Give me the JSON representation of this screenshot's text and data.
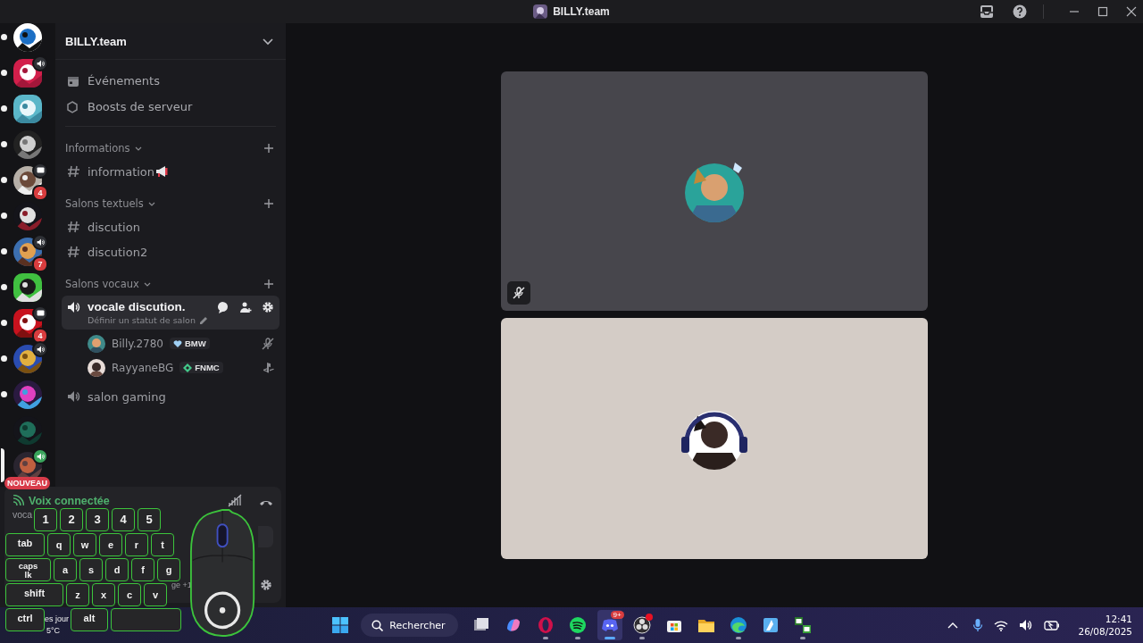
{
  "title_bar": {
    "title": "BILLY.team"
  },
  "servers": [
    {
      "kind": "plain",
      "unread": true,
      "selected": false
    },
    {
      "kind": "voice",
      "unread": true,
      "selected": false
    },
    {
      "kind": "plain",
      "unread": true,
      "selected": false
    },
    {
      "kind": "plain",
      "unread": true,
      "selected": false
    },
    {
      "kind": "message",
      "unread": true,
      "selected": false,
      "badge": "4"
    },
    {
      "kind": "plain",
      "unread": true,
      "selected": false
    },
    {
      "kind": "voice",
      "unread": true,
      "selected": false,
      "badge": "7"
    },
    {
      "kind": "plain",
      "unread": true,
      "selected": false
    },
    {
      "kind": "message",
      "unread": true,
      "selected": false,
      "badge": "4"
    },
    {
      "kind": "voice",
      "unread": true,
      "selected": false
    },
    {
      "kind": "plain",
      "unread": true,
      "selected": false
    },
    {
      "kind": "plain",
      "unread": false,
      "selected": false
    },
    {
      "kind": "voice_live",
      "unread": false,
      "selected": true,
      "tag": "NOUVEAU"
    }
  ],
  "sidebar": {
    "server_name": "BILLY.team",
    "shortcuts": [
      {
        "kind": "events",
        "label": "Événements"
      },
      {
        "kind": "boosts",
        "label": "Boosts de serveur"
      }
    ],
    "categories": [
      {
        "name": "Informations",
        "channels": [
          {
            "kind": "text",
            "name": "information",
            "announce": true,
            "selected": false
          }
        ]
      },
      {
        "name": "Salons textuels",
        "channels": [
          {
            "kind": "text",
            "name": "discution",
            "selected": false
          },
          {
            "kind": "text",
            "name": "discution2",
            "selected": false
          }
        ]
      },
      {
        "name": "Salons vocaux",
        "channels": [
          {
            "kind": "voice",
            "name": "vocale discution.",
            "selected": true,
            "status": "Définir un statut de salon",
            "members": [
              {
                "name": "Billy.2780",
                "tag": {
                  "label": "BMW",
                  "color": "#9fd0f5"
                },
                "muted": true,
                "on_console": false
              },
              {
                "name": "RayyaneBG",
                "tag": {
                  "label": "FNMC",
                  "color": "#43c98a"
                },
                "muted": false,
                "on_console": true
              }
            ]
          },
          {
            "kind": "voice",
            "name": "salon gaming",
            "selected": false
          }
        ]
      }
    ]
  },
  "voice_panel": {
    "title": "Voix connectée",
    "channel": "voca",
    "extra": "ge +1"
  },
  "tiles": [
    {
      "kind": "picture",
      "muted": true
    },
    {
      "kind": "picture",
      "muted": false
    }
  ],
  "overlay": {
    "rows": [
      {
        "keys": [
          {
            "label": "1",
            "kind": "normal"
          },
          {
            "label": "2",
            "kind": "normal"
          },
          {
            "label": "3",
            "kind": "normal"
          },
          {
            "label": "4",
            "kind": "normal"
          },
          {
            "label": "5",
            "kind": "normal"
          }
        ]
      },
      {
        "keys": [
          {
            "label": "tab",
            "kind": "wide"
          },
          {
            "label": "q",
            "kind": "normal"
          },
          {
            "label": "w",
            "kind": "normal"
          },
          {
            "label": "e",
            "kind": "normal"
          },
          {
            "label": "r",
            "kind": "normal"
          },
          {
            "label": "t",
            "kind": "normal"
          }
        ]
      },
      {
        "keys": [
          {
            "label": "caps lk",
            "kind": "wider"
          },
          {
            "label": "a",
            "kind": "normal"
          },
          {
            "label": "s",
            "kind": "normal"
          },
          {
            "label": "d",
            "kind": "normal"
          },
          {
            "label": "f",
            "kind": "normal"
          },
          {
            "label": "g",
            "kind": "normal"
          }
        ]
      },
      {
        "keys": [
          {
            "label": "shift",
            "kind": "widest"
          },
          {
            "label": "z",
            "kind": "normal"
          },
          {
            "label": "x",
            "kind": "normal"
          },
          {
            "label": "c",
            "kind": "normal"
          },
          {
            "label": "v",
            "kind": "normal"
          }
        ]
      },
      {
        "keys": [
          {
            "label": "ctrl",
            "kind": "wide"
          },
          {
            "label": "alt",
            "kind": "wide"
          },
          {
            "kind": "space"
          }
        ]
      }
    ]
  },
  "taskbar": {
    "weather": {
      "line_1": "es jour",
      "line_2": "5°C"
    },
    "search": "Rechercher",
    "apps": [
      {
        "kind": "taskview",
        "running": false,
        "active": false
      },
      {
        "kind": "copilot",
        "running": false,
        "active": false
      },
      {
        "kind": "opera",
        "running": true,
        "active": false
      },
      {
        "kind": "spotify",
        "running": true,
        "active": false
      },
      {
        "kind": "discord",
        "running": true,
        "active": true,
        "badge": "9+"
      },
      {
        "kind": "obs",
        "running": true,
        "active": false,
        "alert": true
      },
      {
        "kind": "store",
        "running": false,
        "active": false
      },
      {
        "kind": "files",
        "running": false,
        "active": false
      },
      {
        "kind": "edge",
        "running": true,
        "active": false
      },
      {
        "kind": "editor",
        "running": false,
        "active": false
      },
      {
        "kind": "nb",
        "running": true,
        "active": false
      }
    ],
    "clock": {
      "time": "12:41",
      "date": "26/08/2025"
    }
  }
}
